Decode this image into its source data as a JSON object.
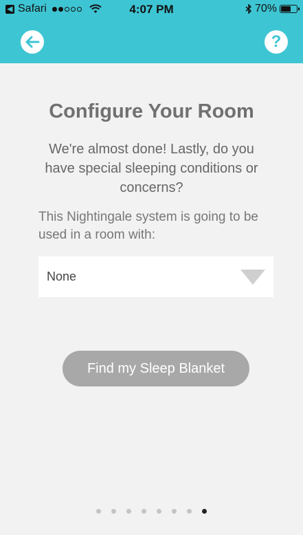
{
  "status_bar": {
    "back_app": "Safari",
    "time": "4:07 PM",
    "battery_text": "70%",
    "battery_level": 0.7,
    "signal_bars": 2,
    "signal_total": 5
  },
  "nav": {
    "back_icon": "arrow-left-icon",
    "help_label": "?"
  },
  "page": {
    "title": "Configure Your Room",
    "subtitle": "We're almost done! Lastly, do you have special sleeping conditions or concerns?",
    "prompt": "This Nightingale system is going to be used in a room with:"
  },
  "room_condition_select": {
    "selected": "None"
  },
  "find_button": {
    "label": "Find my Sleep Blanket"
  },
  "pager": {
    "total": 8,
    "active_index": 7
  },
  "colors": {
    "accent": "#3ec5d3",
    "background": "#f2f2f2",
    "button_disabled": "#a8a8a8"
  }
}
